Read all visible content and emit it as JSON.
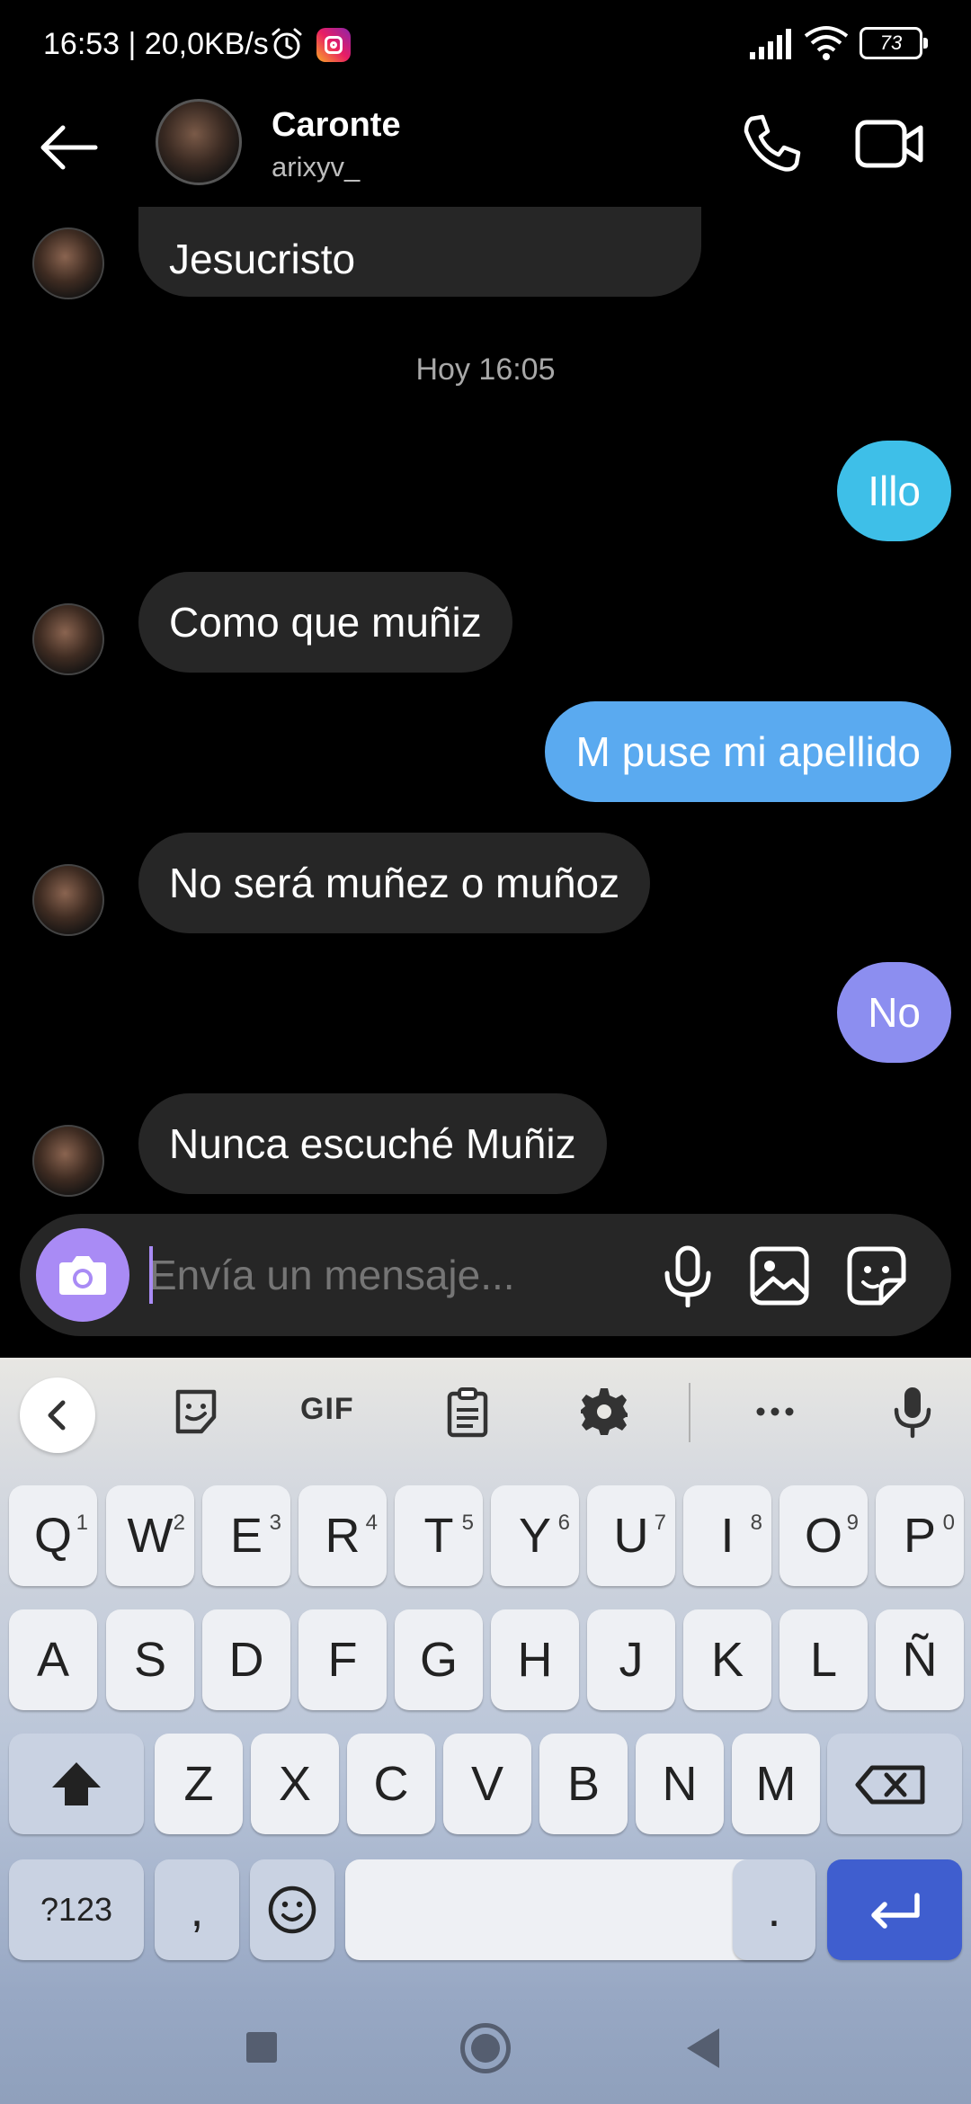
{
  "status_bar": {
    "time_and_speed": "16:53 | 20,0KB/s",
    "battery_level": "73"
  },
  "header": {
    "contact_name": "Caronte",
    "username": "arixyv_"
  },
  "messages": {
    "partial_incoming": "Jesucristo",
    "timestamp": "Hoy 16:05",
    "items": [
      {
        "direction": "out",
        "text": "Illo",
        "color": "#3ebfe8"
      },
      {
        "direction": "in",
        "text": "Como que muñiz"
      },
      {
        "direction": "out",
        "text": "M puse mi apellido",
        "color": "#5aaaf0"
      },
      {
        "direction": "in",
        "text": "No será muñez o muñoz"
      },
      {
        "direction": "out",
        "text": "No",
        "color": "#8c8ef0"
      },
      {
        "direction": "in",
        "text": "Nunca escuché Muñiz"
      }
    ]
  },
  "composer": {
    "placeholder": "Envía un mensaje..."
  },
  "keyboard": {
    "toolbar": {
      "gif_label": "GIF"
    },
    "row1": [
      {
        "key": "Q",
        "hint": "1"
      },
      {
        "key": "W",
        "hint": "2"
      },
      {
        "key": "E",
        "hint": "3"
      },
      {
        "key": "R",
        "hint": "4"
      },
      {
        "key": "T",
        "hint": "5"
      },
      {
        "key": "Y",
        "hint": "6"
      },
      {
        "key": "U",
        "hint": "7"
      },
      {
        "key": "I",
        "hint": "8"
      },
      {
        "key": "O",
        "hint": "9"
      },
      {
        "key": "P",
        "hint": "0"
      }
    ],
    "row2": [
      "A",
      "S",
      "D",
      "F",
      "G",
      "H",
      "J",
      "K",
      "L",
      "Ñ"
    ],
    "row3": [
      "Z",
      "X",
      "C",
      "V",
      "B",
      "N",
      "M"
    ],
    "symbols_label": "?123",
    "comma_label": ",",
    "period_label": "."
  },
  "colors": {
    "accent": "#a98bf5",
    "incoming_bubble": "#262626",
    "enter_key": "#3f5ecf"
  }
}
